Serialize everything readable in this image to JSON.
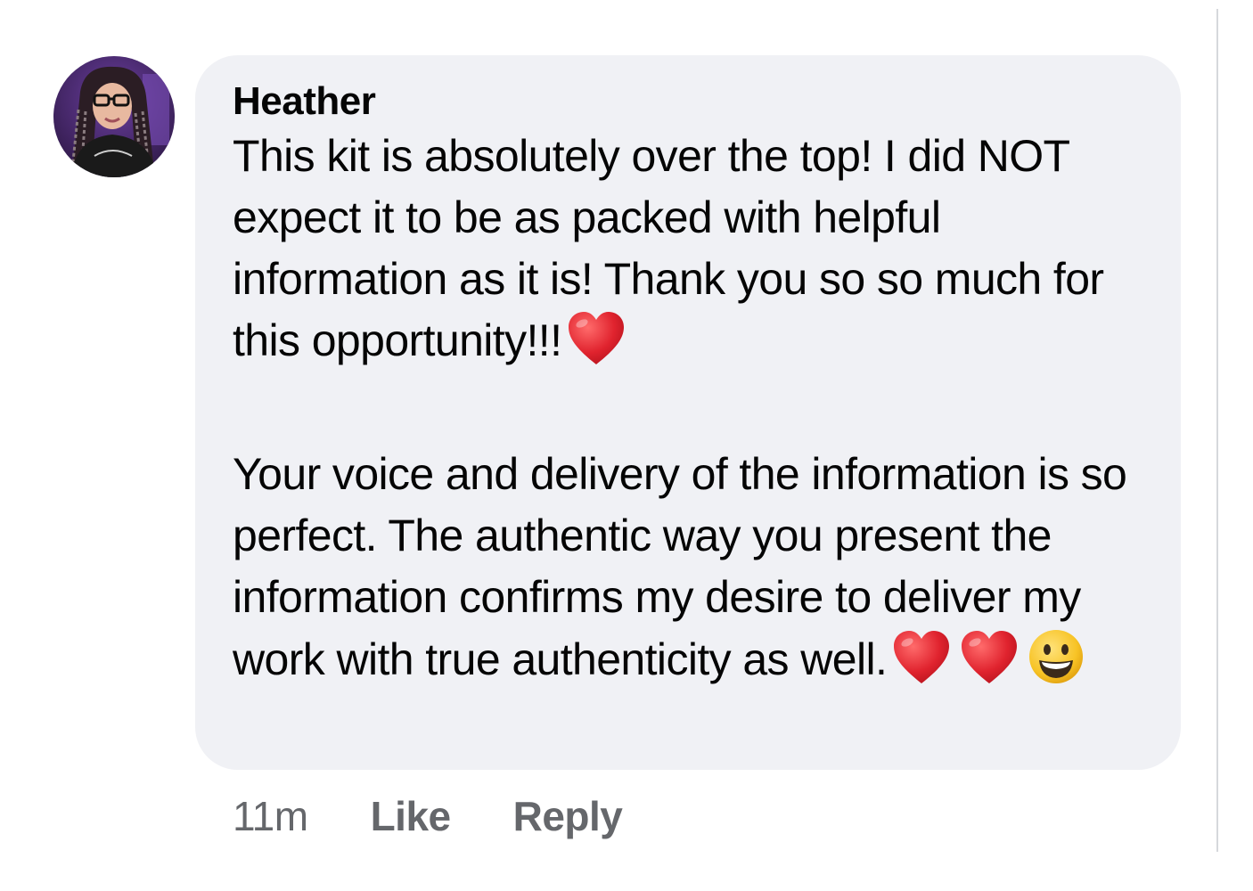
{
  "comment": {
    "author": "Heather",
    "paragraph_1": "This kit is absolutely over the top! I did NOT expect it to be as packed with helpful information as it is! Thank you so so much for this opportunity!!!",
    "paragraph_2": "Your voice and delivery of the information is so perfect. The authentic way you present the information confirms my desire to deliver my work with true authenticity as well.",
    "emoji_after_paragraph_1": [
      "heart-emoji"
    ],
    "emoji_after_paragraph_2": [
      "heart-emoji",
      "heart-emoji",
      "grinning-face-emoji"
    ]
  },
  "actions": {
    "timestamp": "11m",
    "like_label": "Like",
    "reply_label": "Reply"
  },
  "colors": {
    "bubble_background": "#f0f1f5",
    "text": "#050505",
    "meta_text": "#65676b",
    "heart": "#e0232e",
    "smiley": "#f7c325"
  }
}
